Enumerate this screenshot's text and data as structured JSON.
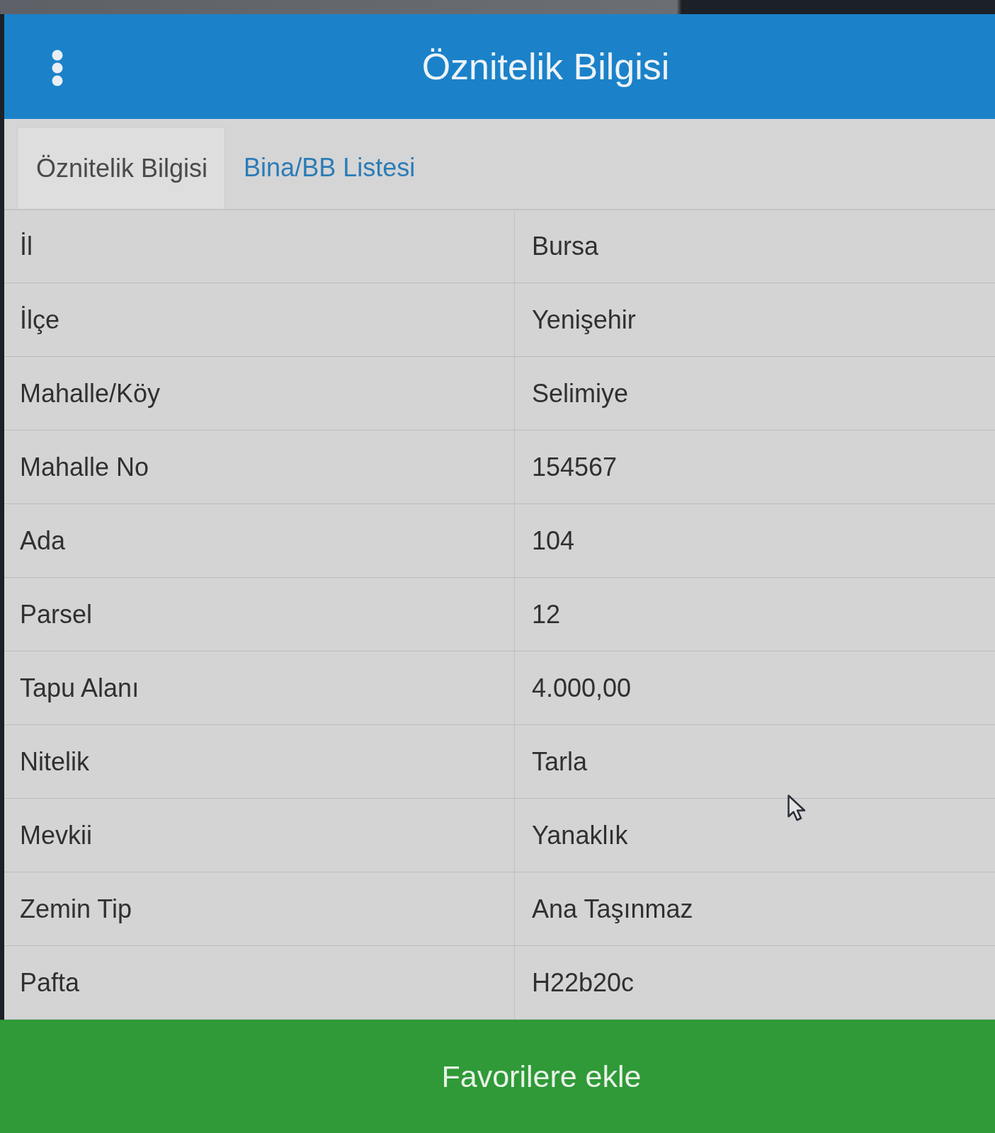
{
  "header": {
    "title": "Öznitelik Bilgisi"
  },
  "tabs": [
    {
      "label": "Öznitelik Bilgisi",
      "selected": true
    },
    {
      "label": "Bina/BB Listesi",
      "selected": false
    }
  ],
  "attributes": [
    {
      "name": "İl",
      "value": "Bursa"
    },
    {
      "name": "İlçe",
      "value": "Yenişehir"
    },
    {
      "name": "Mahalle/Köy",
      "value": "Selimiye"
    },
    {
      "name": "Mahalle No",
      "value": "154567"
    },
    {
      "name": "Ada",
      "value": "104"
    },
    {
      "name": "Parsel",
      "value": "12"
    },
    {
      "name": "Tapu Alanı",
      "value": "4.000,00"
    },
    {
      "name": "Nitelik",
      "value": "Tarla"
    },
    {
      "name": "Mevkii",
      "value": "Yanaklık"
    },
    {
      "name": "Zemin Tip",
      "value": "Ana Taşınmaz"
    },
    {
      "name": "Pafta",
      "value": "H22b20c"
    }
  ],
  "action_button": {
    "label": "Favorilere ekle"
  }
}
